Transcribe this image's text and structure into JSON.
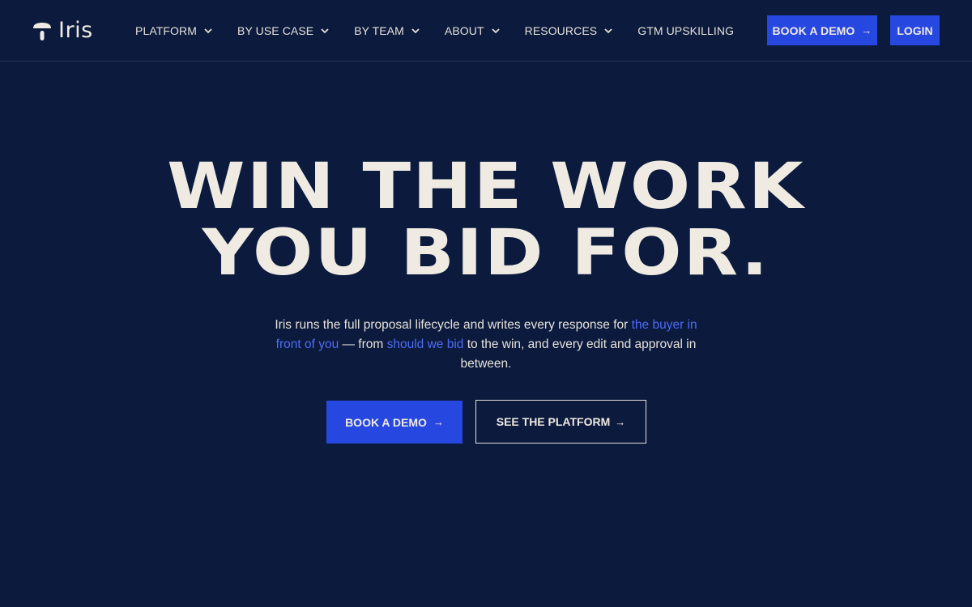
{
  "brand": {
    "name": "Iris"
  },
  "nav": {
    "items": [
      {
        "label": "PLATFORM",
        "has_dropdown": true
      },
      {
        "label": "BY USE CASE",
        "has_dropdown": true
      },
      {
        "label": "BY TEAM",
        "has_dropdown": true
      },
      {
        "label": "ABOUT",
        "has_dropdown": true
      },
      {
        "label": "RESOURCES",
        "has_dropdown": true
      },
      {
        "label": "GTM UPSKILLING",
        "has_dropdown": false
      }
    ],
    "book_demo_label": "BOOK A DEMO",
    "login_label": "LOGIN"
  },
  "hero": {
    "title_line1": "WIN THE WORK",
    "title_line2": "YOU BID FOR.",
    "sub_part1": "Iris runs the full proposal lifecycle and writes every response for ",
    "sub_link1": "the buyer in front of you",
    "sub_part2": " — from ",
    "sub_link2": "should we bid",
    "sub_part3": " to the win, and every edit and approval in between.",
    "primary_cta": "BOOK A DEMO",
    "secondary_cta": "SEE THE PLATFORM"
  },
  "icons": {
    "arrow": "→",
    "chevron": "chevron-down-icon",
    "logo": "iris-logo-icon"
  },
  "colors": {
    "background": "#0b1a3d",
    "accent": "#2748e0",
    "link": "#4d6cf5",
    "text": "#f0ebe2"
  }
}
